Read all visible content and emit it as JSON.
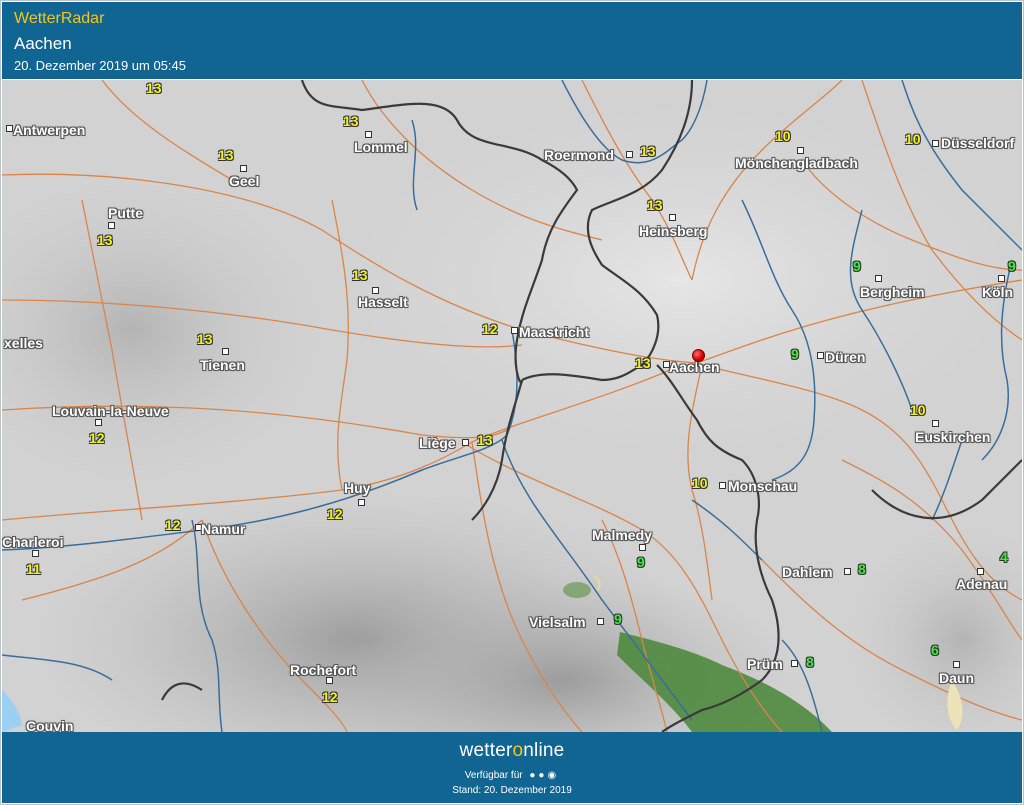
{
  "header": {
    "title": "WetterRadar",
    "location": "Aachen",
    "timestamp": "20. Dezember 2019 um 05:45"
  },
  "footer": {
    "brand_before": "wetter",
    "brand_o": "o",
    "brand_after": "nline",
    "available": "Verfügbar für",
    "platform_icons": [
      "android-icon",
      "apple-icon",
      "windows-icon"
    ],
    "stand": "Stand: 20. Dezember 2019"
  },
  "colors": {
    "header_bg": "#106592",
    "accent_yellow": "#f4c51f",
    "temp_yellow": "#f2f21c",
    "temp_green": "#44e644",
    "roads": "#d9854a",
    "borders": "#3a3a3a",
    "rivers": "#3a6d9a",
    "precipitation": "#4e8a3e"
  },
  "map": {
    "cities": [
      {
        "id": "antwerpen",
        "name": "Antwerpen"
      },
      {
        "id": "lommel",
        "name": "Lommel"
      },
      {
        "id": "geel",
        "name": "Geel"
      },
      {
        "id": "putte",
        "name": "Putte"
      },
      {
        "id": "roermond",
        "name": "Roermond"
      },
      {
        "id": "moenchengladbach",
        "name": "Mönchengladbach"
      },
      {
        "id": "duesseldorf",
        "name": "Düsseldorf"
      },
      {
        "id": "heinsberg",
        "name": "Heinsberg"
      },
      {
        "id": "bergheim",
        "name": "Bergheim"
      },
      {
        "id": "koeln",
        "name": "Köln"
      },
      {
        "id": "hasselt",
        "name": "Hasselt"
      },
      {
        "id": "maastricht",
        "name": "Maastricht"
      },
      {
        "id": "bruxelles",
        "name": "xelles"
      },
      {
        "id": "tienen",
        "name": "Tienen"
      },
      {
        "id": "aachen",
        "name": "Aachen"
      },
      {
        "id": "dueren",
        "name": "Düren"
      },
      {
        "id": "louvain",
        "name": "Louvain-la-Neuve"
      },
      {
        "id": "euskirchen",
        "name": "Euskirchen"
      },
      {
        "id": "liege",
        "name": "Liège"
      },
      {
        "id": "huy",
        "name": "Huy"
      },
      {
        "id": "monschau",
        "name": "Monschau"
      },
      {
        "id": "charleroi",
        "name": "Charleroi"
      },
      {
        "id": "namur",
        "name": "Namur"
      },
      {
        "id": "malmedy",
        "name": "Malmedy"
      },
      {
        "id": "dahlem",
        "name": "Dahlem"
      },
      {
        "id": "adenau",
        "name": "Adenau"
      },
      {
        "id": "vielsalm",
        "name": "Vielsalm"
      },
      {
        "id": "pruem",
        "name": "Prüm"
      },
      {
        "id": "daun",
        "name": "Daun"
      },
      {
        "id": "rochefort",
        "name": "Rochefort"
      },
      {
        "id": "couvin",
        "name": "Couvin"
      }
    ],
    "temperatures": [
      {
        "id": "t1",
        "value": "13"
      },
      {
        "id": "t2",
        "value": "13"
      },
      {
        "id": "t3",
        "value": "13"
      },
      {
        "id": "t4",
        "value": "13"
      },
      {
        "id": "t5",
        "value": "13"
      },
      {
        "id": "t6",
        "value": "10"
      },
      {
        "id": "t7",
        "value": "10"
      },
      {
        "id": "t8",
        "value": "13"
      },
      {
        "id": "t9",
        "value": "9"
      },
      {
        "id": "t10",
        "value": "9"
      },
      {
        "id": "t11",
        "value": "13"
      },
      {
        "id": "t12",
        "value": "12"
      },
      {
        "id": "t13",
        "value": "13"
      },
      {
        "id": "t14",
        "value": "13"
      },
      {
        "id": "t15",
        "value": "9"
      },
      {
        "id": "t16",
        "value": "12"
      },
      {
        "id": "t17",
        "value": "10"
      },
      {
        "id": "t18",
        "value": "13"
      },
      {
        "id": "t19",
        "value": "12"
      },
      {
        "id": "t20",
        "value": "10"
      },
      {
        "id": "t21",
        "value": "11"
      },
      {
        "id": "t22",
        "value": "12"
      },
      {
        "id": "t23",
        "value": "9"
      },
      {
        "id": "t24",
        "value": "8"
      },
      {
        "id": "t25",
        "value": "4"
      },
      {
        "id": "t26",
        "value": "9"
      },
      {
        "id": "t27",
        "value": "8"
      },
      {
        "id": "t28",
        "value": "6"
      },
      {
        "id": "t29",
        "value": "12"
      }
    ]
  }
}
